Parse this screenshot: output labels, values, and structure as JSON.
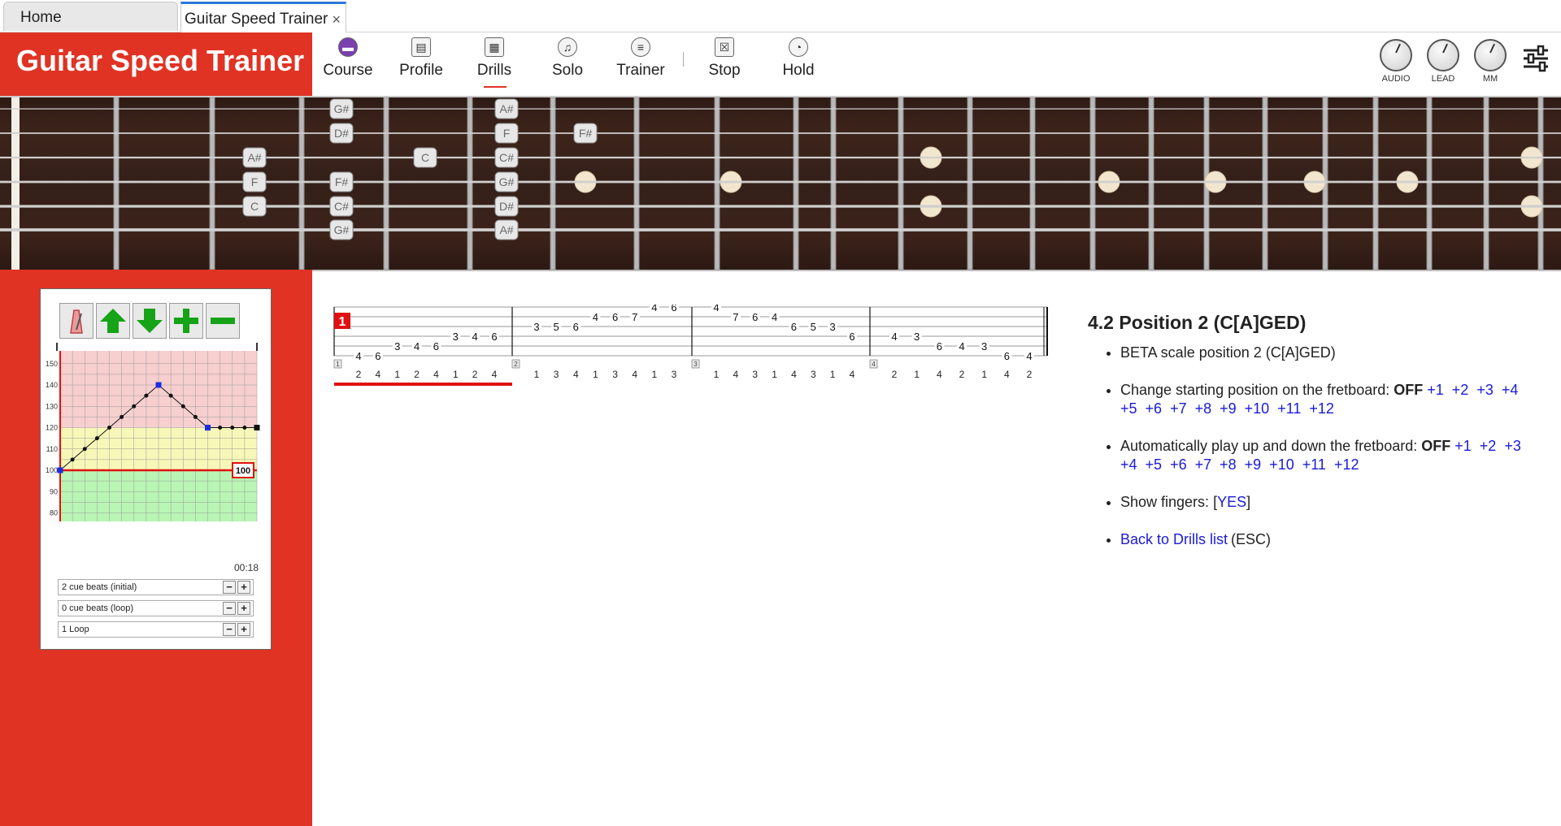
{
  "tabs": {
    "home": "Home",
    "active": "Guitar Speed Trainer",
    "close_glyph": "×"
  },
  "header": {
    "title": "Guitar Speed Trainer",
    "accent_color": "#e03324",
    "nav": [
      {
        "label": "Course",
        "icon": "book-icon"
      },
      {
        "label": "Profile",
        "icon": "profile-icon"
      },
      {
        "label": "Drills",
        "icon": "grid-icon"
      },
      {
        "label": "Solo",
        "icon": "music-note-icon"
      },
      {
        "label": "Trainer",
        "icon": "trainer-icon"
      },
      {
        "label": "Stop",
        "icon": "stop-icon"
      },
      {
        "label": "Hold",
        "icon": "hold-icon"
      }
    ],
    "knobs": [
      {
        "label": "AUDIO"
      },
      {
        "label": "LEAD"
      },
      {
        "label": "MM"
      }
    ],
    "settings_icon": "sliders-icon"
  },
  "fretboard": {
    "notes": [
      {
        "string": 1,
        "fret": 4,
        "label": "G#"
      },
      {
        "string": 1,
        "fret": 6,
        "label": "A#"
      },
      {
        "string": 2,
        "fret": 4,
        "label": "D#"
      },
      {
        "string": 2,
        "fret": 6,
        "label": "F"
      },
      {
        "string": 2,
        "fret": 7,
        "label": "F#"
      },
      {
        "string": 3,
        "fret": 3,
        "label": "A#"
      },
      {
        "string": 3,
        "fret": 5,
        "label": "C"
      },
      {
        "string": 3,
        "fret": 6,
        "label": "C#"
      },
      {
        "string": 4,
        "fret": 3,
        "label": "F"
      },
      {
        "string": 4,
        "fret": 4,
        "label": "F#"
      },
      {
        "string": 4,
        "fret": 6,
        "label": "G#"
      },
      {
        "string": 5,
        "fret": 3,
        "label": "C"
      },
      {
        "string": 5,
        "fret": 4,
        "label": "C#"
      },
      {
        "string": 5,
        "fret": 6,
        "label": "D#"
      },
      {
        "string": 6,
        "fret": 4,
        "label": "G#"
      },
      {
        "string": 6,
        "fret": 6,
        "label": "A#"
      }
    ]
  },
  "speed_trainer": {
    "chart": {
      "type": "line",
      "y_ticks": [
        "150",
        "140",
        "130",
        "120",
        "110",
        "100",
        "90",
        "80"
      ],
      "ylim": [
        76,
        156
      ],
      "x": [
        0,
        1,
        2,
        3,
        4,
        5,
        6,
        7,
        8,
        9,
        10,
        11,
        12,
        13,
        14,
        15,
        16
      ],
      "values": [
        100,
        105,
        110,
        115,
        120,
        125,
        130,
        135,
        140,
        135,
        130,
        125,
        120,
        120,
        120,
        120,
        120
      ],
      "key_points": [
        0,
        8,
        12,
        16
      ],
      "target_tempo": "100",
      "zones": [
        {
          "from": 76,
          "to": 100,
          "color": "#b9f5b4"
        },
        {
          "from": 100,
          "to": 120,
          "color": "#f7f7b8"
        },
        {
          "from": 120,
          "to": 156,
          "color": "#f7cfcf"
        }
      ]
    },
    "elapsed": "00:18",
    "cue_rows": [
      {
        "label": "2 cue beats (initial)"
      },
      {
        "label": "0 cue beats (loop)"
      },
      {
        "label": "1 Loop"
      }
    ],
    "minus_glyph": "−",
    "plus_glyph": "+"
  },
  "tab_notation": {
    "measure_badge": "1",
    "measures": [
      {
        "index": "1",
        "fingers": [
          "2",
          "4",
          "1",
          "2",
          "4",
          "1",
          "2",
          "4"
        ]
      },
      {
        "index": "2",
        "fingers": [
          "1",
          "3",
          "4",
          "1",
          "3",
          "4",
          "1",
          "3"
        ]
      },
      {
        "index": "3",
        "fingers": [
          "1",
          "4",
          "3",
          "1",
          "4",
          "3",
          "1",
          "4"
        ]
      },
      {
        "index": "4",
        "fingers": [
          "2",
          "1",
          "4",
          "2",
          "1",
          "4",
          "2"
        ]
      }
    ],
    "notes": [
      [
        {
          "s": 6,
          "t": "4"
        },
        {
          "s": 6,
          "t": "6"
        },
        {
          "s": 5,
          "t": "3"
        },
        {
          "s": 5,
          "t": "4"
        },
        {
          "s": 5,
          "t": "6"
        },
        {
          "s": 4,
          "t": "3"
        },
        {
          "s": 4,
          "t": "4"
        },
        {
          "s": 4,
          "t": "6"
        }
      ],
      [
        {
          "s": 3,
          "t": "3"
        },
        {
          "s": 3,
          "t": "5"
        },
        {
          "s": 3,
          "t": "6"
        },
        {
          "s": 2,
          "t": "4"
        },
        {
          "s": 2,
          "t": "6"
        },
        {
          "s": 2,
          "t": "7"
        },
        {
          "s": 1,
          "t": "4"
        },
        {
          "s": 1,
          "t": "6"
        }
      ],
      [
        {
          "s": 1,
          "t": "4"
        },
        {
          "s": 2,
          "t": "7"
        },
        {
          "s": 2,
          "t": "6"
        },
        {
          "s": 2,
          "t": "4"
        },
        {
          "s": 3,
          "t": "6"
        },
        {
          "s": 3,
          "t": "5"
        },
        {
          "s": 3,
          "t": "3"
        },
        {
          "s": 4,
          "t": "6"
        }
      ],
      [
        {
          "s": 4,
          "t": "4"
        },
        {
          "s": 4,
          "t": "3"
        },
        {
          "s": 5,
          "t": "6"
        },
        {
          "s": 5,
          "t": "4"
        },
        {
          "s": 5,
          "t": "3"
        },
        {
          "s": 6,
          "t": "6"
        },
        {
          "s": 6,
          "t": "4"
        }
      ]
    ]
  },
  "info": {
    "title": "4.2 Position 2 (C[A]GED)",
    "items": {
      "desc": "BETA scale position 2 (C[A]GED)",
      "start_label": "Change starting position on the fretboard:",
      "start_state": "OFF",
      "start_options": [
        "+1",
        "+2",
        "+3",
        "+4",
        "+5",
        "+6",
        "+7",
        "+8",
        "+9",
        "+10",
        "+11",
        "+12"
      ],
      "auto_label": "Automatically play up and down the fretboard:",
      "auto_state": "OFF",
      "auto_options": [
        "+1",
        "+2",
        "+3",
        "+4",
        "+5",
        "+6",
        "+7",
        "+8",
        "+9",
        "+10",
        "+11",
        "+12"
      ],
      "fingers_label": "Show fingers:",
      "fingers_open": "[",
      "fingers_value": "YES",
      "fingers_close": "]",
      "back_label": "Back to Drills list",
      "back_hint": "(ESC)"
    }
  }
}
